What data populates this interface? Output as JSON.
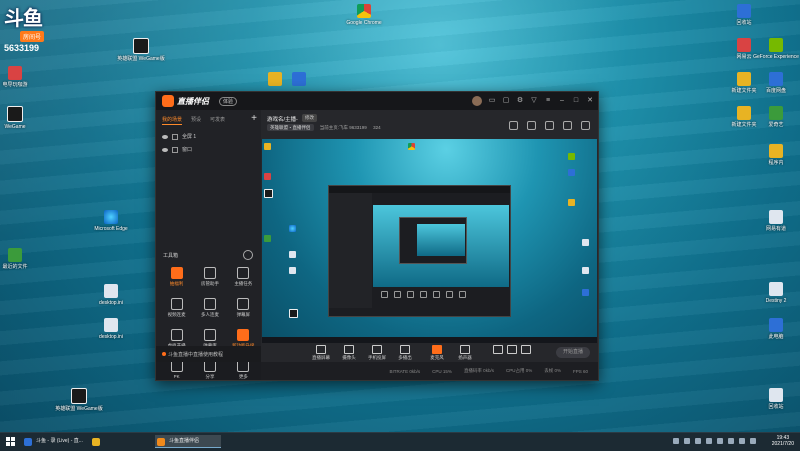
{
  "desktop": {
    "douyu": {
      "logo": "斗鱼",
      "tag": "房间号",
      "room": "5633199"
    },
    "icons": [
      {
        "label": "程序内",
        "x": "l1"
      },
      {
        "label": "电导玩咖游",
        "x": "l2"
      },
      {
        "label": "WeGame",
        "x": "l3"
      },
      {
        "label": "Microsoft Edge"
      },
      {
        "label": "最近的文件"
      },
      {
        "label": "desktop.ini"
      },
      {
        "label": "desktop.ini"
      },
      {
        "label": "英雄联盟 WeGame版"
      },
      {
        "label": "英雄联盟 WeGame版"
      },
      {
        "label": "Google Chrome"
      },
      {
        "label": "回收站"
      },
      {
        "label": "GeForce Experience"
      },
      {
        "label": "网易云"
      },
      {
        "label": "新建文件夹"
      },
      {
        "label": "新建文件夹"
      },
      {
        "label": "百度网盘"
      },
      {
        "label": "爱奇艺"
      },
      {
        "label": "网易有道"
      },
      {
        "label": "Destiny 2"
      },
      {
        "label": "此电脑"
      },
      {
        "label": "回收站"
      }
    ]
  },
  "app": {
    "name": "直播伴侣",
    "version_badge": "体验",
    "sidebar": {
      "tabs": [
        "我的场景",
        "预设",
        "可发表"
      ],
      "scenes": [
        "全屏 1",
        "窗口"
      ],
      "tools_title": "工具箱",
      "tools": [
        {
          "label": "抽福利",
          "hot": true
        },
        {
          "label": "房管助手",
          "hot": false
        },
        {
          "label": "主播任务",
          "hot": false
        },
        {
          "label": "视频连麦",
          "hot": false
        },
        {
          "label": "多人连麦",
          "hot": false
        },
        {
          "label": "弹幕屏",
          "hot": false
        },
        {
          "label": "虚拟开播",
          "hot": false
        },
        {
          "label": "弹幕库",
          "hot": false
        },
        {
          "label": "新功能升级",
          "hot": true
        },
        {
          "label": "PK",
          "hot": false
        },
        {
          "label": "分享",
          "hot": false
        },
        {
          "label": "更多",
          "hot": false
        }
      ],
      "footer": "斗鱼直播中直播使用教程"
    },
    "main": {
      "stream_title": "游戏名/主播-",
      "edit_label": "修改",
      "category": "英雄联盟・直播伴侣",
      "meta": "当前主页:飞车 9633199",
      "followers": "324"
    },
    "controls": [
      {
        "label": "直播屏幕",
        "orange": false
      },
      {
        "label": "摄像头",
        "orange": false
      },
      {
        "label": "手机投屏",
        "orange": false
      },
      {
        "label": "多播出",
        "orange": false
      },
      {
        "label": "麦克风",
        "orange": true
      },
      {
        "label": "扬声器",
        "orange": false
      }
    ],
    "start_button": "开始直播",
    "status": [
      "BITRATE 0kb/s",
      "CPU 15%",
      "直播码率 0kb/s",
      "CPU占用 0%",
      "丢帧 0%",
      "FPS 60"
    ]
  },
  "taskbar": {
    "items": [
      {
        "label": "斗鱼 - 录 (Live) - 直...",
        "active": false
      },
      {
        "label": "",
        "active": false
      },
      {
        "label": "斗鱼直播伴侣",
        "active": true
      }
    ],
    "time": "19:43",
    "date": "2021/7/20"
  },
  "colors": {
    "accent": "#ff6d1a",
    "window_bg": "#1b1c20",
    "taskbar": "#1c2a33"
  }
}
